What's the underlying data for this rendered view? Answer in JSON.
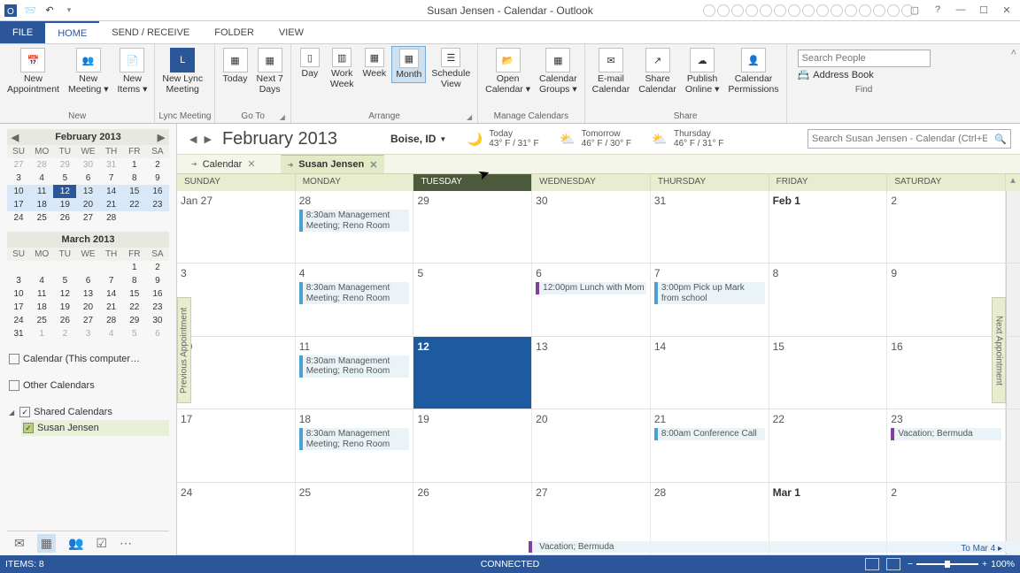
{
  "window": {
    "title": "Susan Jensen - Calendar - Outlook"
  },
  "ribbon": {
    "tabs": [
      "FILE",
      "HOME",
      "SEND / RECEIVE",
      "FOLDER",
      "VIEW"
    ],
    "active_tab": "HOME",
    "groups": {
      "new": {
        "label": "New",
        "appointment": "New\nAppointment",
        "meeting": "New\nMeeting ▾",
        "items": "New\nItems ▾"
      },
      "lync": {
        "label": "Lync Meeting",
        "btn": "New Lync\nMeeting"
      },
      "goto": {
        "label": "Go To",
        "today": "Today",
        "next7": "Next 7\nDays"
      },
      "arrange": {
        "label": "Arrange",
        "day": "Day",
        "work": "Work\nWeek",
        "week": "Week",
        "month": "Month",
        "schedule": "Schedule\nView"
      },
      "manage": {
        "label": "Manage Calendars",
        "open": "Open\nCalendar ▾",
        "groups": "Calendar\nGroups ▾"
      },
      "share": {
        "label": "Share",
        "email": "E-mail\nCalendar",
        "share": "Share\nCalendar",
        "publish": "Publish\nOnline ▾",
        "perms": "Calendar\nPermissions"
      },
      "find": {
        "label": "Find",
        "search_ph": "Search People",
        "ab": "Address Book"
      }
    }
  },
  "sidebar": {
    "feb": {
      "title": "February 2013",
      "dow": [
        "SU",
        "MO",
        "TU",
        "WE",
        "TH",
        "FR",
        "SA"
      ],
      "rows": [
        [
          "27",
          "28",
          "29",
          "30",
          "31",
          "1",
          "2"
        ],
        [
          "3",
          "4",
          "5",
          "6",
          "7",
          "8",
          "9"
        ],
        [
          "10",
          "11",
          "12",
          "13",
          "14",
          "15",
          "16"
        ],
        [
          "17",
          "18",
          "19",
          "20",
          "21",
          "22",
          "23"
        ],
        [
          "24",
          "25",
          "26",
          "27",
          "28",
          "",
          ""
        ]
      ],
      "selected": "12"
    },
    "mar": {
      "title": "March 2013",
      "dow": [
        "SU",
        "MO",
        "TU",
        "WE",
        "TH",
        "FR",
        "SA"
      ],
      "rows": [
        [
          "",
          "",
          "",
          "",
          "",
          "1",
          "2"
        ],
        [
          "3",
          "4",
          "5",
          "6",
          "7",
          "8",
          "9"
        ],
        [
          "10",
          "11",
          "12",
          "13",
          "14",
          "15",
          "16"
        ],
        [
          "17",
          "18",
          "19",
          "20",
          "21",
          "22",
          "23"
        ],
        [
          "24",
          "25",
          "26",
          "27",
          "28",
          "29",
          "30"
        ],
        [
          "31",
          "1",
          "2",
          "3",
          "4",
          "5",
          "6"
        ]
      ]
    },
    "calendars": {
      "this_computer": "Calendar (This computer…",
      "other": "Other Calendars",
      "shared_hdr": "Shared Calendars",
      "susan": "Susan Jensen"
    }
  },
  "calendar": {
    "month": "February 2013",
    "location": "Boise, ID",
    "weather": [
      {
        "label": "Today",
        "temp": "43° F / 31° F",
        "icon": "🌙"
      },
      {
        "label": "Tomorrow",
        "temp": "46° F / 30° F",
        "icon": "⛅"
      },
      {
        "label": "Thursday",
        "temp": "46° F / 31° F",
        "icon": "⛅"
      }
    ],
    "search_ph": "Search Susan Jensen - Calendar (Ctrl+E)",
    "tabs": {
      "calendar": "Calendar",
      "susan": "Susan Jensen"
    },
    "dow": [
      "SUNDAY",
      "MONDAY",
      "TUESDAY",
      "WEDNESDAY",
      "THURSDAY",
      "FRIDAY",
      "SATURDAY"
    ],
    "prev_appt": "Previous Appointment",
    "next_appt": "Next Appointment",
    "to_link": "To Mar 4  ▸",
    "weeks": [
      [
        {
          "d": "Jan 27"
        },
        {
          "d": "28",
          "e": [
            {
              "t": "8:30am Management Meeting; Reno Room"
            }
          ]
        },
        {
          "d": "29"
        },
        {
          "d": "30"
        },
        {
          "d": "31"
        },
        {
          "d": "Feb 1",
          "b": true
        },
        {
          "d": "2"
        }
      ],
      [
        {
          "d": "3"
        },
        {
          "d": "4",
          "e": [
            {
              "t": "8:30am Management Meeting; Reno Room"
            }
          ]
        },
        {
          "d": "5"
        },
        {
          "d": "6",
          "e": [
            {
              "t": "12:00pm Lunch with Mom",
              "c": "purple"
            }
          ]
        },
        {
          "d": "7",
          "e": [
            {
              "t": "3:00pm Pick up Mark from school"
            }
          ]
        },
        {
          "d": "8"
        },
        {
          "d": "9"
        }
      ],
      [
        {
          "d": "10"
        },
        {
          "d": "11",
          "e": [
            {
              "t": "8:30am Management Meeting; Reno Room"
            }
          ]
        },
        {
          "d": "12",
          "today": true
        },
        {
          "d": "13"
        },
        {
          "d": "14"
        },
        {
          "d": "15"
        },
        {
          "d": "16"
        }
      ],
      [
        {
          "d": "17"
        },
        {
          "d": "18",
          "e": [
            {
              "t": "8:30am Management Meeting; Reno Room"
            }
          ]
        },
        {
          "d": "19"
        },
        {
          "d": "20"
        },
        {
          "d": "21",
          "e": [
            {
              "t": "8:00am Conference Call"
            }
          ]
        },
        {
          "d": "22"
        },
        {
          "d": "23",
          "e": [
            {
              "t": "Vacation; Bermuda",
              "c": "purple"
            }
          ]
        }
      ],
      [
        {
          "d": "24"
        },
        {
          "d": "25"
        },
        {
          "d": "26"
        },
        {
          "d": "27",
          "span": "Vacation; Bermuda"
        },
        {
          "d": "28"
        },
        {
          "d": "Mar 1",
          "b": true
        },
        {
          "d": "2"
        }
      ]
    ]
  },
  "status": {
    "items": "ITEMS: 8",
    "connected": "CONNECTED",
    "zoom": "100%"
  }
}
